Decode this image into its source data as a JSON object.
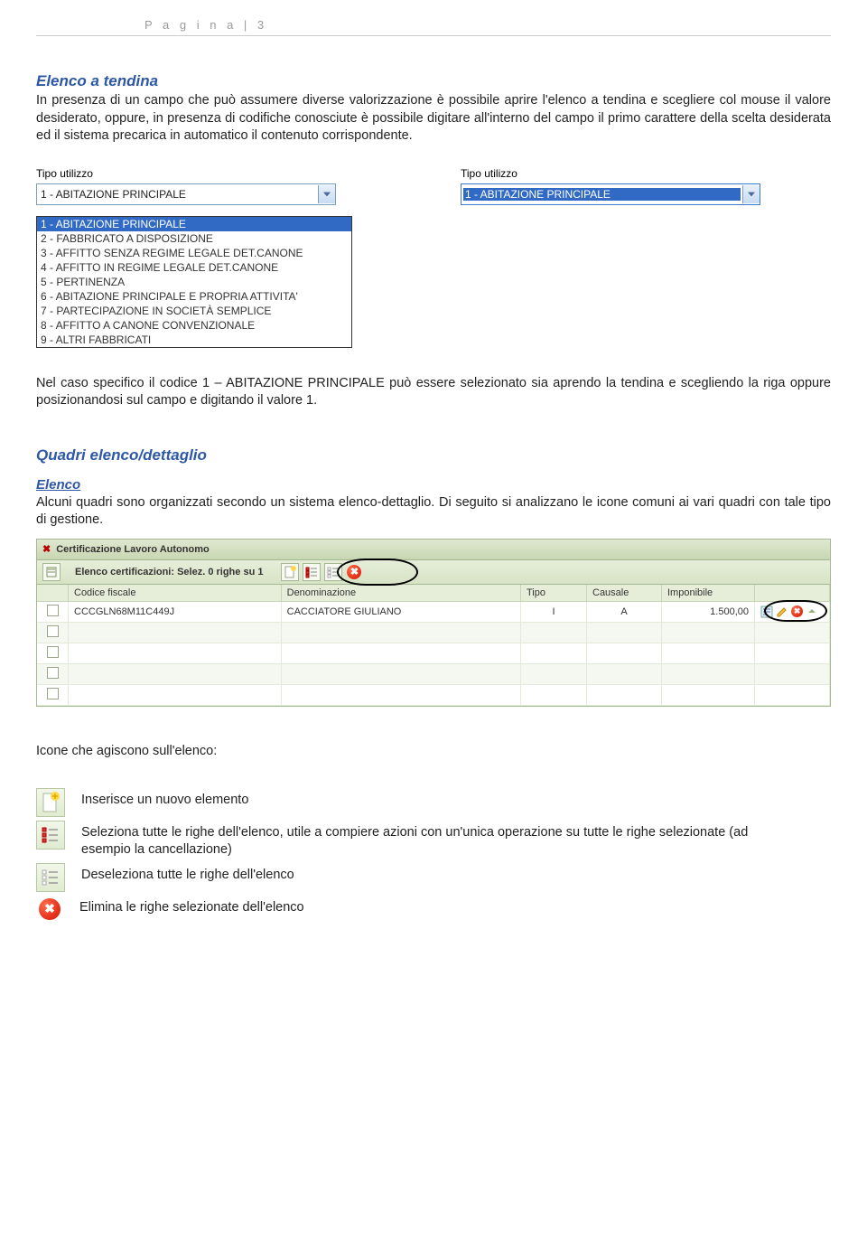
{
  "page_header": "P a g i n a  | 3",
  "section1": {
    "title": "Elenco a tendina",
    "body": "In presenza di un campo che può assumere diverse valorizzazione è possibile aprire l'elenco a tendina e scegliere col mouse il valore desiderato, oppure, in presenza di codifiche conosciute è possibile digitare all'interno del campo il primo carattere della scelta desiderata ed il sistema precarica in automatico il contenuto corrispondente."
  },
  "dropdown": {
    "label": "Tipo utilizzo",
    "selected": "1 - ABITAZIONE PRINCIPALE",
    "options": [
      "1 - ABITAZIONE PRINCIPALE",
      "2 - FABBRICATO A DISPOSIZIONE",
      "3 - AFFITTO SENZA REGIME LEGALE DET.CANONE",
      "4 - AFFITTO IN REGIME LEGALE DET.CANONE",
      "5 - PERTINENZA",
      "6 - ABITAZIONE PRINCIPALE E PROPRIA ATTIVITA'",
      "7 - PARTECIPAZIONE IN SOCIETÀ SEMPLICE",
      "8 - AFFITTO A CANONE CONVENZIONALE",
      "9 - ALTRI FABBRICATI"
    ]
  },
  "section1_note": "Nel caso specifico il codice 1 – ABITAZIONE PRINCIPALE può essere selezionato sia aprendo la tendina e scegliendo la riga oppure posizionandosi sul campo e digitando il valore 1.",
  "section2": {
    "title": "Quadri  elenco/dettaglio",
    "sub": "Elenco",
    "body": "Alcuni quadri sono organizzati secondo un sistema elenco-dettaglio. Di seguito si analizzano le icone comuni ai vari quadri con tale tipo di gestione."
  },
  "panel": {
    "title": "Certificazione Lavoro Autonomo",
    "toolbar_label": "Elenco certificazioni: Selez. 0 righe su 1",
    "columns": [
      "Codice fiscale",
      "Denominazione",
      "Tipo",
      "Causale",
      "Imponibile"
    ],
    "row": {
      "cf": "CCCGLN68M11C449J",
      "den": "CACCIATORE GIULIANO",
      "tipo": "I",
      "causale": "A",
      "imponibile": "1.500,00"
    }
  },
  "icons_intro": "Icone che agiscono sull'elenco:",
  "icons": {
    "add": "Inserisce un nuovo elemento",
    "select_all": "Seleziona tutte le righe dell'elenco, utile a compiere azioni con un'unica operazione su tutte le righe selezionate (ad esempio la cancellazione)",
    "deselect_all": "Deseleziona tutte le righe dell'elenco",
    "delete": "Elimina le righe selezionate dell'elenco"
  }
}
